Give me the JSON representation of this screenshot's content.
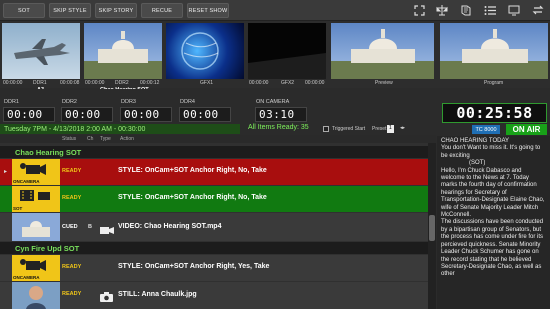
{
  "toolbar": {
    "buttons": [
      "SOT",
      "SKIP STYLE",
      "SKIP STORY",
      "RECUE",
      "RESET SHOW"
    ]
  },
  "thumbnails": [
    {
      "tc": "00:00:00",
      "source": "DDR1",
      "tc2": "00:00:08",
      "name": "A3"
    },
    {
      "tc": "00:00:00",
      "source": "DDR2",
      "tc2": "00:00:12",
      "name": "Chao Hearing SOT"
    },
    {
      "source": "GFX1"
    },
    {
      "tc": "00:00:00",
      "source": "GFX2",
      "tc2": "00:00:00"
    },
    {
      "name": "Preview"
    },
    {
      "name": "Program"
    }
  ],
  "timecodes": [
    {
      "label": "DDR1",
      "value": "00:00"
    },
    {
      "label": "DDR2",
      "value": "00:00"
    },
    {
      "label": "DDR3",
      "value": "00:00"
    },
    {
      "label": "DDR4",
      "value": "00:00"
    },
    {
      "label": "ON CAMERA",
      "value": "03:10"
    }
  ],
  "show_bar": "Tuesday 7PM - 4/13/2018 2:00 AM - 00:30:00",
  "all_ready": "All Items Ready: 35",
  "triggered_start": "Triggered Start",
  "preset_label": "Preset",
  "preset_value": "1",
  "clock": "00:25:58",
  "tc_badge": "TC 8000",
  "on_air": "ON AIR",
  "rundown_headers": {
    "status": "Status",
    "ch": "Ch",
    "type": "Type",
    "action": "Action"
  },
  "groups": [
    "Chao Hearing SOT",
    "Cyn Fire Upd SOT"
  ],
  "rows": [
    {
      "icon_label": "ONCAMERA",
      "status": "READY",
      "content": "STYLE: OnCam+SOT    Anchor Right, No, Take"
    },
    {
      "icon_label": "SOT",
      "status": "READY",
      "content": "STYLE: OnCam+SOT    Anchor Right, No, Take"
    },
    {
      "icon_label": "",
      "status": "CUED",
      "ch": "B",
      "content": "VIDEO: Chao Hearing SOT.mp4"
    },
    {
      "icon_label": "ONCAMERA",
      "status": "READY",
      "content": "STYLE: OnCam+SOT    Anchor Right, Yes, Take"
    },
    {
      "icon_label": "",
      "status": "READY",
      "content": "STILL: Anna Chaulk.jpg"
    }
  ],
  "script": {
    "title": "CHAO HEARING TODAY",
    "lines": [
      "You don't Want to miss it.  It's going to be exciting",
      "(SOT)",
      "Hello, I'm Chuck Dabasco and welcome to the News at 7. Today marks the fourth day of confirmation hearings for Secretary of Transportation-Designate Elaine Chao, wife of Senate Majority Leader Mitch McConnell.",
      "The discussions have been conducted by a bipartisan group of Senators, but the process has come under fire for its percieved quickness. Senate Minority Leader Chuck Schumer has gone on the record stating that he believed Secretary-Designate Chao, as well as other"
    ]
  },
  "colors": {
    "ready_red": "#a80e0e",
    "ready_green": "#117a11",
    "accent_green": "#7ff25c",
    "icon_yellow": "#f0c518"
  }
}
